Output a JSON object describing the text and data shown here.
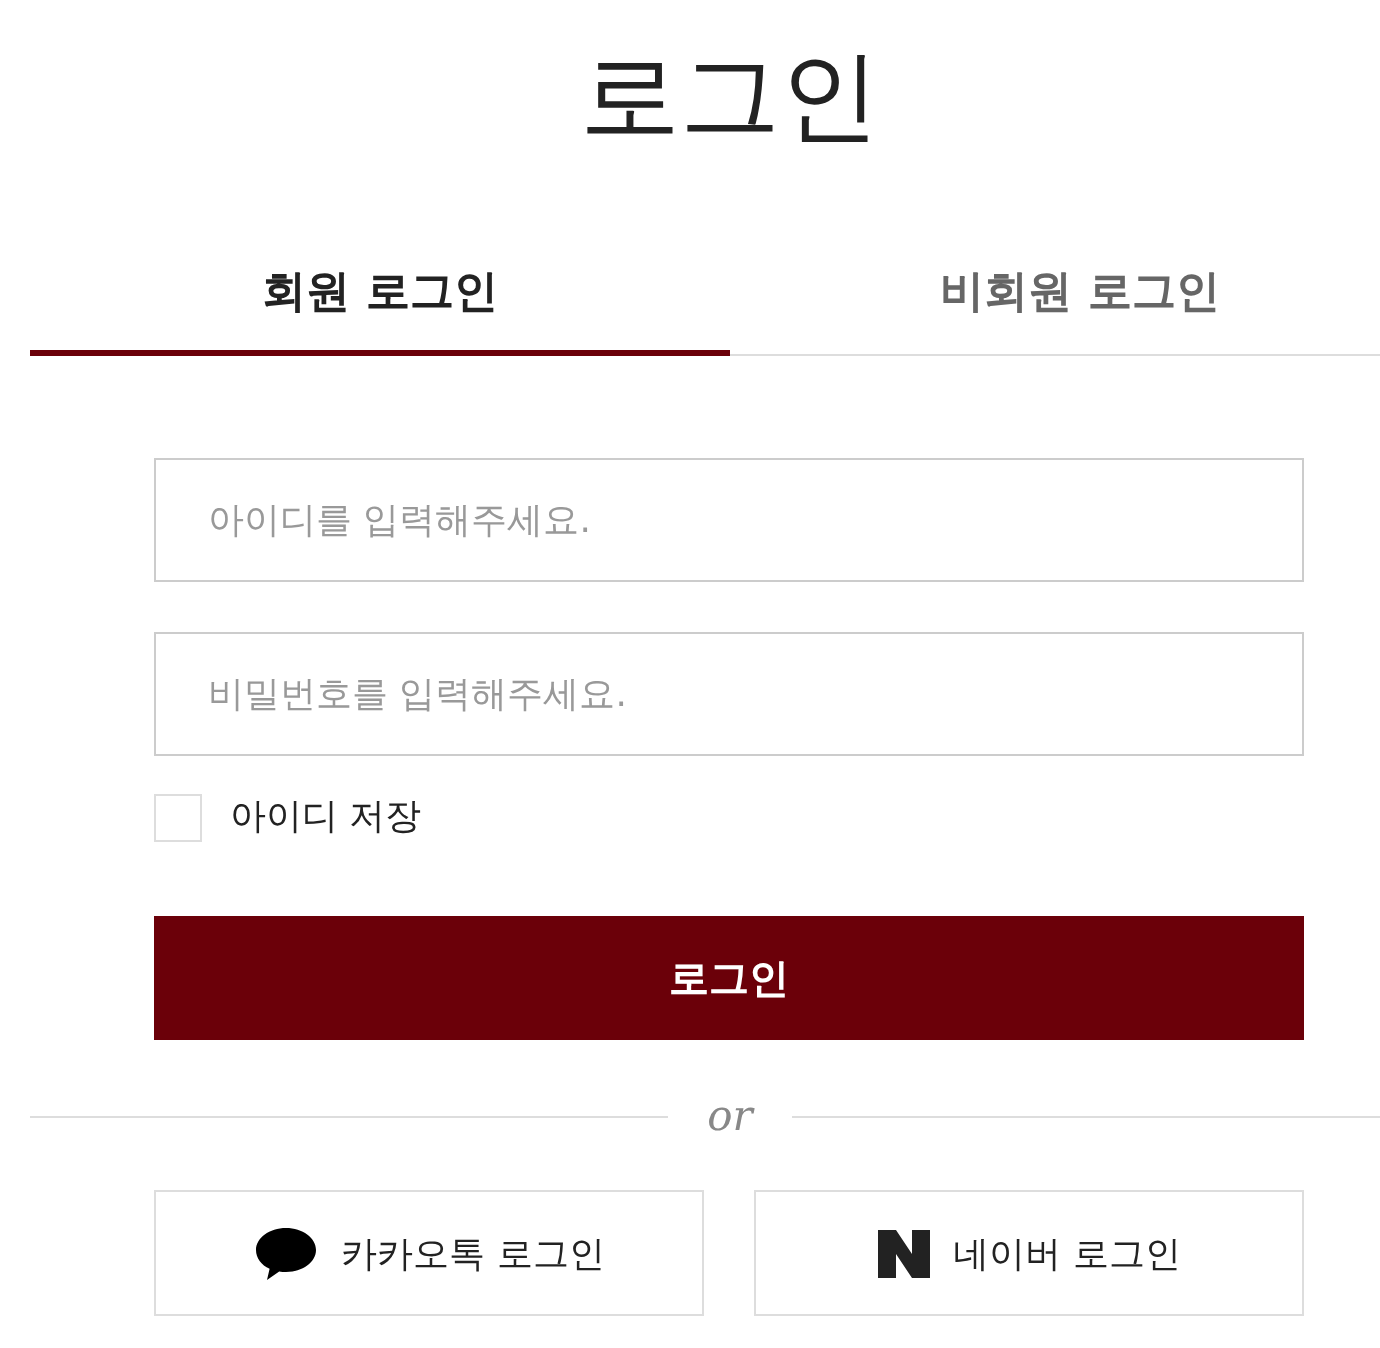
{
  "title": "로그인",
  "tabs": [
    {
      "label": "회원 로그인",
      "selected": true
    },
    {
      "label": "비회원 로그인",
      "selected": false
    }
  ],
  "form": {
    "id_field": {
      "placeholder": "아이디를 입력해주세요."
    },
    "password_field": {
      "placeholder": "비밀번호를 입력해주세요."
    },
    "remember_id": {
      "label": "아이디 저장",
      "checked": false
    },
    "submit": "로그인"
  },
  "divider": "or",
  "social_logins": [
    {
      "kind": "kakao",
      "label": "카카오톡 로그인"
    },
    {
      "kind": "naver",
      "label": "네이버 로그인"
    }
  ]
}
